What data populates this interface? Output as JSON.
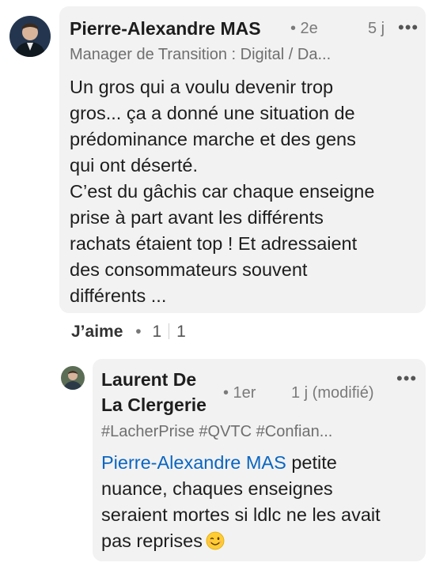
{
  "comment1": {
    "author": "Pierre-Alexandre MAS",
    "degree": "• 2e",
    "time": "5 j",
    "headline": "Manager de Transition : Digital / Da...",
    "more": "•••",
    "body_lines": [
      "Un gros qui a voulu devenir trop",
      "gros... ça a donné une situation de",
      "prédominance marche et des gens",
      "qui ont déserté.",
      "C’est du gâchis car chaque enseigne",
      "prise à part avant les différents",
      "rachats étaient top ! Et adressaient",
      "des consommateurs souvent",
      "différents ..."
    ]
  },
  "comment1_actions": {
    "like_label": "J’aime",
    "dot": "•",
    "like_count": "1",
    "reply_count": "1"
  },
  "reply1": {
    "author_line1": "Laurent De",
    "author_line2": "La Clergerie",
    "degree": "• 1er",
    "time": "1 j (modifié)",
    "headline": "#LacherPrise #QVTC #Confian...",
    "more": "•••",
    "mention": "Pierre-Alexandre MAS",
    "body_line1_rest": " petite",
    "body_lines": [
      "nuance, chaques enseignes",
      "seraient mortes si ldlc ne les avait"
    ],
    "body_last": "pas reprises",
    "emoji": "winking-face-emoji"
  }
}
